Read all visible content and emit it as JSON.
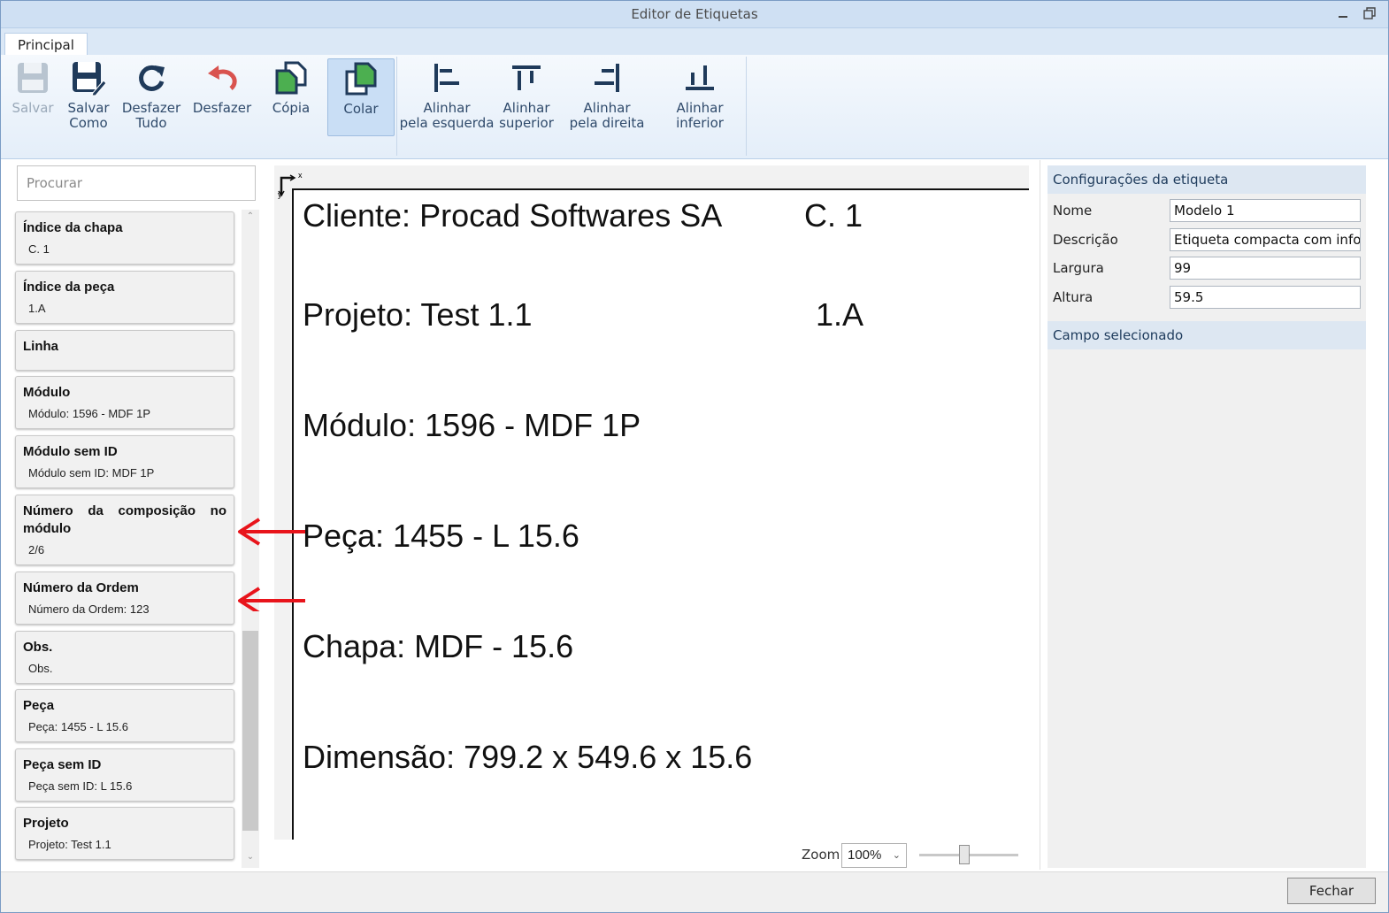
{
  "window": {
    "title": "Editor de Etiquetas"
  },
  "tabs": [
    {
      "label": "Principal"
    }
  ],
  "toolbar": {
    "save_label": "Salvar",
    "save_as_label_1": "Salvar",
    "save_as_label_2": "Como",
    "undo_all_label_1": "Desfazer",
    "undo_all_label_2": "Tudo",
    "undo_label": "Desfazer",
    "copy_label": "Cópia",
    "paste_label": "Colar",
    "align_left_1": "Alinhar",
    "align_left_2": "pela esquerda",
    "align_top_1": "Alinhar",
    "align_top_2": "superior",
    "align_right_1": "Alinhar",
    "align_right_2": "pela direita",
    "align_bottom_1": "Alinhar",
    "align_bottom_2": "inferior"
  },
  "search": {
    "placeholder": "Procurar"
  },
  "fields": [
    {
      "title": "Índice da chapa",
      "value": "C. 1"
    },
    {
      "title": "Índice da peça",
      "value": "1.A"
    },
    {
      "title": "Linha",
      "value": ""
    },
    {
      "title": "Módulo",
      "value": "Módulo: 1596 - MDF 1P"
    },
    {
      "title": "Módulo sem ID",
      "value": "Módulo sem ID: MDF 1P"
    },
    {
      "title": "Número da composição no módulo",
      "value": "2/6"
    },
    {
      "title": "Número da Ordem",
      "value": "Número da Ordem: 123"
    },
    {
      "title": "Obs.",
      "value": "Obs."
    },
    {
      "title": "Peça",
      "value": "Peça: 1455 - L 15.6"
    },
    {
      "title": "Peça sem ID",
      "value": "Peça sem ID: L 15.6"
    },
    {
      "title": "Projeto",
      "value": "Projeto: Test 1.1"
    }
  ],
  "label_preview": {
    "origin_x": "x",
    "origin_y": "y",
    "lines": [
      "Cliente: Procad Softwares SA",
      "C. 1",
      "Projeto: Test 1.1",
      "1.A",
      "Módulo: 1596 - MDF 1P",
      "Peça: 1455 - L 15.6",
      "Chapa: MDF - 15.6",
      "Dimensão: 799.2 x 549.6 x 15.6"
    ]
  },
  "zoom": {
    "label": "Zoom",
    "value": "100%",
    "slider_fraction": 0.45
  },
  "settings": {
    "header": "Configurações da etiqueta",
    "name_label": "Nome",
    "name_value": "Modelo 1",
    "desc_label": "Descrição",
    "desc_value": "Etiqueta compacta com informações",
    "width_label": "Largura",
    "width_value": "99",
    "height_label": "Altura",
    "height_value": "59.5",
    "selected_header": "Campo selecionado"
  },
  "footer": {
    "close_label": "Fechar"
  },
  "colors": {
    "accent": "#cfe0f3",
    "annotation_arrow": "#e8141b",
    "copy_icon": "#4caf50",
    "undo_icon": "#d9534f"
  }
}
